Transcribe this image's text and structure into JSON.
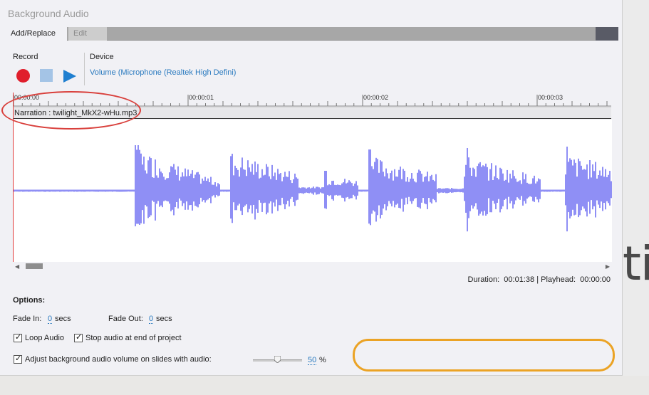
{
  "window": {
    "title": "Background Audio"
  },
  "tabs": [
    {
      "label": "Add/Replace",
      "active": true
    },
    {
      "label": "Edit",
      "active": false
    }
  ],
  "record": {
    "label": "Record"
  },
  "device": {
    "label": "Device",
    "value": "Volume (Microphone (Realtek High Defini)"
  },
  "ruler": {
    "ticks": [
      "00:00:00",
      "00:00:01",
      "00:00:02",
      "00:00:03"
    ]
  },
  "narration": {
    "text": "Narration : twilight_MkX2-wHu.mp3"
  },
  "status": {
    "duration_label": "Duration:",
    "duration_value": "00:01:38",
    "separator": "|",
    "playhead_label": "Playhead:",
    "playhead_value": "00:00:00"
  },
  "options": {
    "heading": "Options:",
    "fade_in_label": "Fade In:",
    "fade_in_value": "0",
    "fade_out_label": "Fade Out:",
    "fade_out_value": "0",
    "secs": "secs",
    "loop_audio": {
      "label": "Loop Audio",
      "checked": true
    },
    "stop_audio": {
      "label": "Stop audio at end of project",
      "checked": true
    },
    "adjust_volume": {
      "label": "Adjust background audio volume on slides with audio:",
      "checked": true,
      "value": "50",
      "unit": "%",
      "level": 0.5
    }
  },
  "background": {
    "text": "ti"
  },
  "colors": {
    "waveform": "#8f8ff5",
    "accent": "#2a7abf",
    "record": "#e01e2c",
    "annotation_red": "#d9403c",
    "annotation_orange": "#eba325"
  },
  "icons": [
    "record-icon",
    "stop-icon",
    "play-icon",
    "scroll-left-icon",
    "scroll-right-icon",
    "check-icon"
  ]
}
